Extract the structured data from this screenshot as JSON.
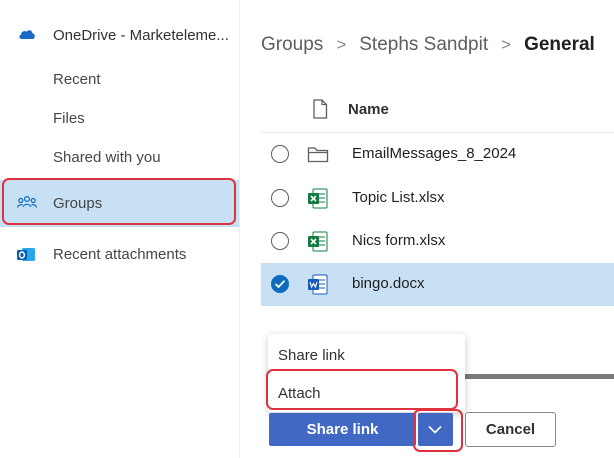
{
  "sidebar": {
    "onedrive_title": "OneDrive - Marketeleme...",
    "items": [
      {
        "label": "Recent"
      },
      {
        "label": "Files"
      },
      {
        "label": "Shared with you"
      },
      {
        "label": "Groups",
        "selected": true
      },
      {
        "label": "Recent attachments"
      }
    ]
  },
  "breadcrumb": {
    "items": [
      "Groups",
      "Stephs Sandpit",
      "General"
    ],
    "separator": ">"
  },
  "list": {
    "header": {
      "name_label": "Name"
    },
    "rows": [
      {
        "name": "EmailMessages_8_2024",
        "type": "folder",
        "selected": false
      },
      {
        "name": "Topic List.xlsx",
        "type": "excel",
        "selected": false
      },
      {
        "name": "Nics form.xlsx",
        "type": "excel",
        "selected": false
      },
      {
        "name": "bingo.docx",
        "type": "word",
        "selected": true
      }
    ]
  },
  "share_menu": {
    "items": [
      {
        "label": "Share link"
      },
      {
        "label": "Attach"
      }
    ]
  },
  "footer": {
    "primary_label": "Share link",
    "cancel_label": "Cancel"
  },
  "colors": {
    "accent": "#4169c4",
    "selected_bg": "#c7e0f4",
    "highlight_red": "#e0313e",
    "excel_green": "#107c41",
    "word_blue": "#185abd"
  },
  "icons": {
    "onedrive": "cloud-icon",
    "groups": "people-icon",
    "recent_attachments": "outlook-icon",
    "header_file": "file-icon",
    "folder": "folder-icon",
    "excel": "excel-file-icon",
    "word": "word-file-icon",
    "checked": "checkmark-icon",
    "split": "chevron-down-icon"
  }
}
